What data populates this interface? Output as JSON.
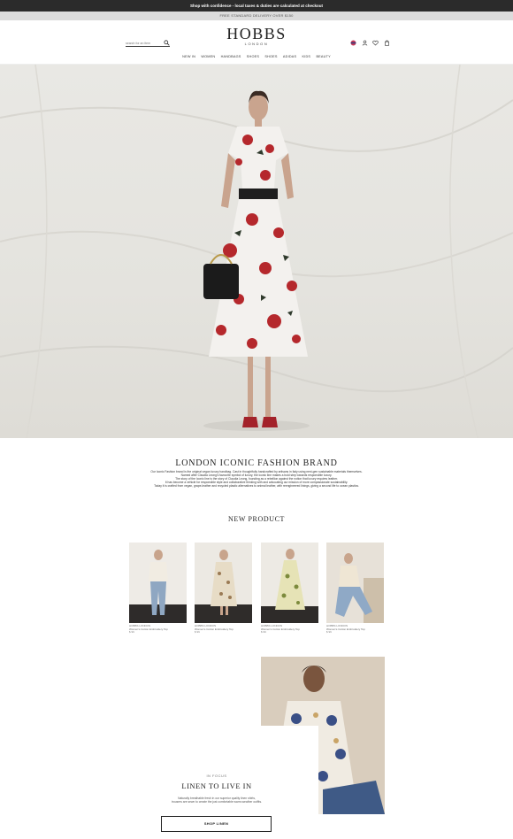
{
  "banner": {
    "promo": "Shop with confidence - local taxes & duties are calculated at checkout",
    "shipping": "FREE STANDARD DELIVERY OVER $150"
  },
  "header": {
    "logo": "HOBBS",
    "logo_sub": "LONDON",
    "search_placeholder": "search for an item",
    "icons": [
      "flag-icon",
      "account-icon",
      "wishlist-icon",
      "bag-icon"
    ],
    "nav": [
      "NEW IN",
      "WOMEN",
      "HANDBAGS",
      "SHOES",
      "SHOES",
      "ADIDAS",
      "KIDS",
      "BEAUTY"
    ]
  },
  "brand": {
    "title": "LONDON ICONIC FASHION BRAND",
    "lines": [
      "Our Iconic Fashion brand is the original vegan luxury handbag. Cast in thoughtfully handcrafted by artisans in Italy using next-gen sustainable materials themselves.",
      "Named after Claudia Leong's favourite symbol of luxury, the iconic line makes a bold step towards responsible luxury.",
      "The story of the Iconic line is the story of Claudia Leong, founding as a rebellion against the notion that luxury requires leather.",
      "It has become a vehicle for responsible style and collaborative thinking with and advocating our mission of more compassionate sustainability.",
      "Today it is crafted from vegan, grape-leather and recycled plastic alternatives to animal leather, with reengineered linings, giving a second life to ocean plastics."
    ]
  },
  "new_product": {
    "title": "NEW PRODUCT",
    "items": [
      {
        "name": "HOBBS LONDON",
        "desc": "Women's Cotton Embroidery Top",
        "price": "$ 99"
      },
      {
        "name": "HOBBS LONDON",
        "desc": "Women's Cotton Embroidery Top",
        "price": "$ 99"
      },
      {
        "name": "HOBBS LONDON",
        "desc": "Women's Cotton Embroidery Top",
        "price": "$ 99"
      },
      {
        "name": "HOBBS LONDON",
        "desc": "Women's Cotton Embroidery Top",
        "price": "$ 99"
      }
    ]
  },
  "focus": {
    "kicker": "IN FOCUS",
    "title": "LINEN TO LIVE IN",
    "text_1": "Naturally breathable fresh in our superior quality linen shirts,",
    "text_2": "trousers are sewn to create the just comfortable warm-weather outfits.",
    "button": "SHOP LINEN"
  },
  "colors": {
    "topbar": "#2b2b2b",
    "subbar": "#dcdcdc",
    "hero_bg": "#e6e5e0",
    "text": "#222222"
  }
}
